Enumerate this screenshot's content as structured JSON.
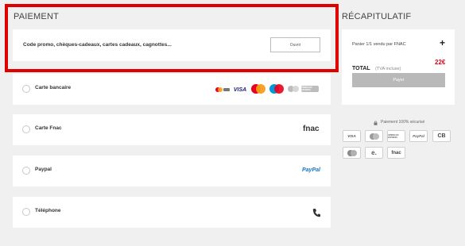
{
  "payment": {
    "title": "PAIEMENT",
    "promo_label": "Code promo, chèques-cadeaux, cartes cadeaux, cagnottes...",
    "open_button": "Ouvrir",
    "options": [
      {
        "label": "Carte bancaire"
      },
      {
        "label": "Carte Fnac",
        "logo_text": "fnac"
      },
      {
        "label": "Paypal",
        "logo_text": "PayPal"
      },
      {
        "label": "Téléphone"
      }
    ],
    "card_logos": {
      "visa": "VISA",
      "amex": "AMERICAN EXPRESS"
    }
  },
  "summary": {
    "title": "RÉCAPITULATIF",
    "cart_line": "Panier 1/1 vendu par FNAC",
    "expand_symbol": "+",
    "total_label": "TOTAL",
    "total_note": "(TVA incluse)",
    "total_value": "22€",
    "pay_button": "Payer",
    "secure_text": "Paiement 100% sécurisé",
    "logos": {
      "visa": "VISA",
      "amex": "AMERICAN EXPRESS",
      "paypal": "PayPal",
      "cb": "CB",
      "e": "e.",
      "fnac": "fnac"
    }
  },
  "colors": {
    "highlight": "#e00000",
    "total": "#e2001a",
    "paypal": "#1a74c4",
    "mastercard_red": "#eb001b",
    "mastercard_orange": "#f79e1b"
  }
}
